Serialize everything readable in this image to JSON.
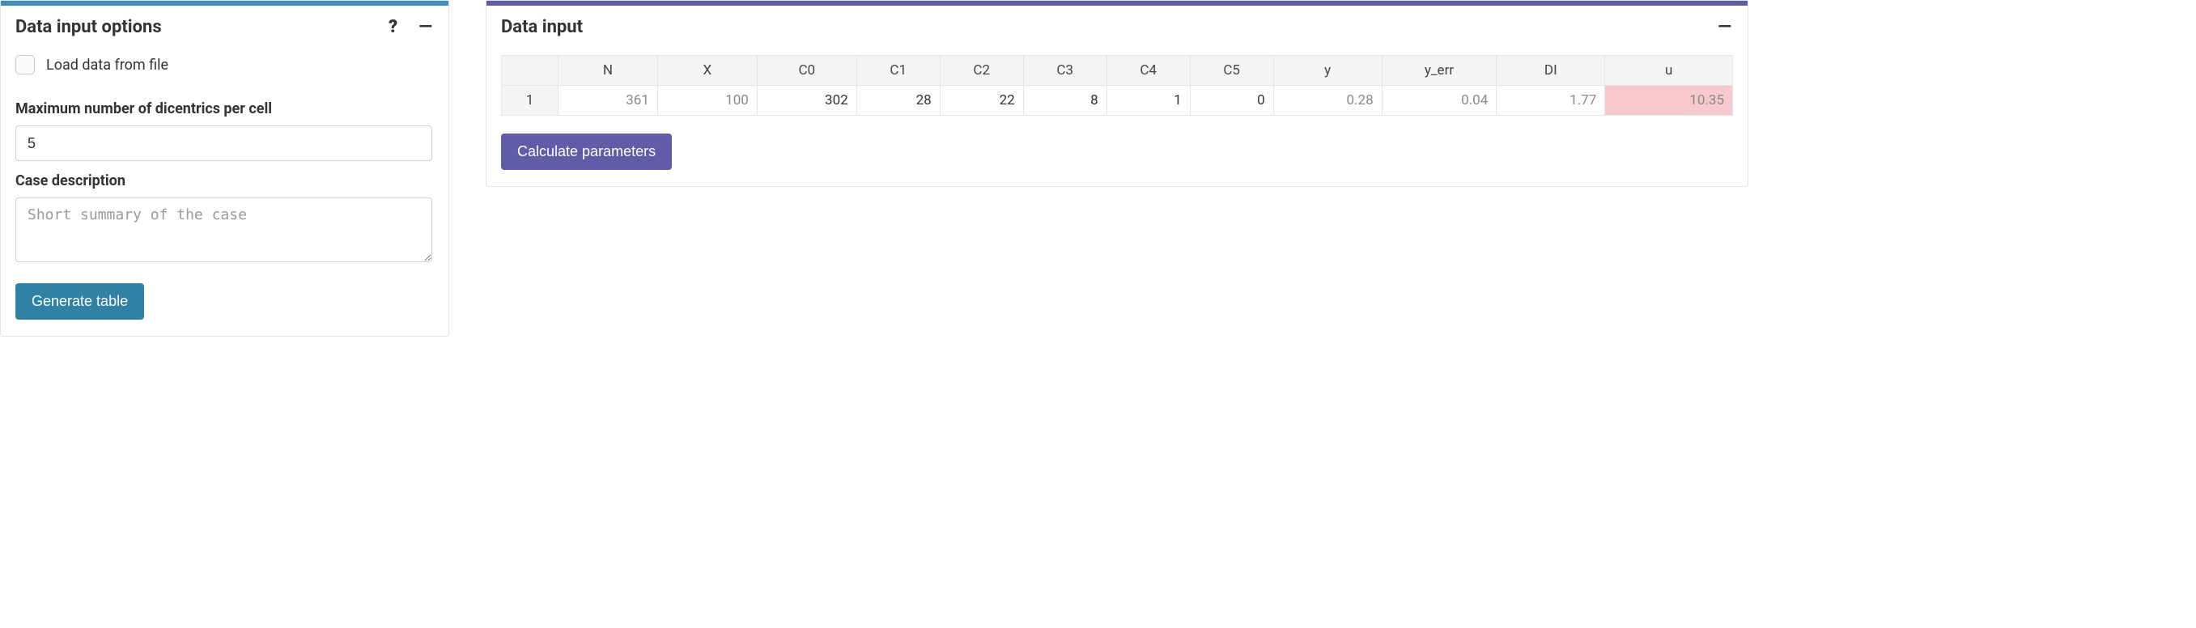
{
  "left_panel": {
    "title": "Data input options",
    "checkbox_label": "Load data from file",
    "max_label": "Maximum number of dicentrics per cell",
    "max_value": "5",
    "desc_label": "Case description",
    "desc_placeholder": "Short summary of the case",
    "generate_btn": "Generate table"
  },
  "right_panel": {
    "title": "Data input",
    "columns": [
      "",
      "N",
      "X",
      "C0",
      "C1",
      "C2",
      "C3",
      "C4",
      "C5",
      "y",
      "y_err",
      "DI",
      "u"
    ],
    "row_index": "1",
    "row": {
      "N": "361",
      "X": "100",
      "C0": "302",
      "C1": "28",
      "C2": "22",
      "C3": "8",
      "C4": "1",
      "C5": "0",
      "y": "0.28",
      "y_err": "0.04",
      "DI": "1.77",
      "u": "10.35"
    },
    "calc_btn": "Calculate parameters"
  },
  "icons": {
    "help": "?",
    "minimize": "—"
  }
}
